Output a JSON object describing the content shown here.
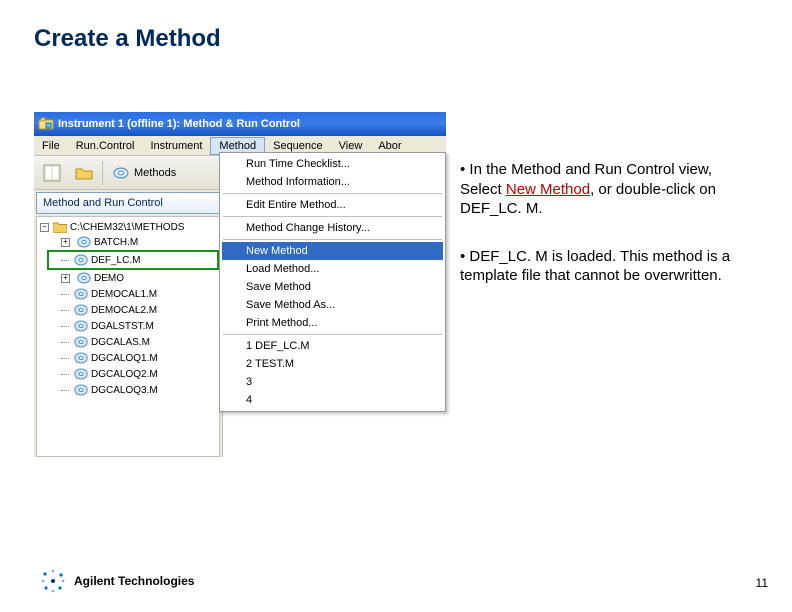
{
  "slide": {
    "title": "Create a Method",
    "page_number": "11"
  },
  "window": {
    "title": "Instrument 1 (offline 1): Method & Run Control"
  },
  "menubar": {
    "items": [
      "File",
      "Run.Control",
      "Instrument",
      "Method",
      "Sequence",
      "View",
      "Abor"
    ],
    "active_index": 3
  },
  "toolbar": {
    "methods_label": "Methods"
  },
  "nav": {
    "header": "Method and Run Control"
  },
  "tree": {
    "root": "C:\\CHEM32\\1\\METHODS",
    "items": [
      {
        "label": "BATCH.M",
        "expander": "plus"
      },
      {
        "label": "DEF_LC.M",
        "highlighted": true
      },
      {
        "label": "DEMO",
        "expander": "plus"
      },
      {
        "label": "DEMOCAL1.M"
      },
      {
        "label": "DEMOCAL2.M"
      },
      {
        "label": "DGALSTST.M"
      },
      {
        "label": "DGCALAS.M"
      },
      {
        "label": "DGCALOQ1.M"
      },
      {
        "label": "DGCALOQ2.M"
      },
      {
        "label": "DGCALOQ3.M"
      }
    ]
  },
  "dropdown": {
    "sections": [
      [
        "Run Time Checklist...",
        "Method Information..."
      ],
      [
        "Edit Entire Method..."
      ],
      [
        "Method Change History..."
      ],
      [
        "New Method",
        "Load Method...",
        "Save Method",
        "Save Method As...",
        "Print Method..."
      ],
      [
        "1 DEF_LC.M",
        "2 TEST.M",
        "3",
        "4"
      ]
    ],
    "highlighted": "New Method"
  },
  "content": {
    "bullet1_pre": "• In the Method and Run Control view, Select ",
    "bullet1_link": "New Method",
    "bullet1_post": ", or double-click on DEF_LC. M.",
    "bullet2": "• DEF_LC. M is loaded.  This method is a template file that cannot be overwritten."
  },
  "footer": {
    "company": "Agilent Technologies"
  }
}
